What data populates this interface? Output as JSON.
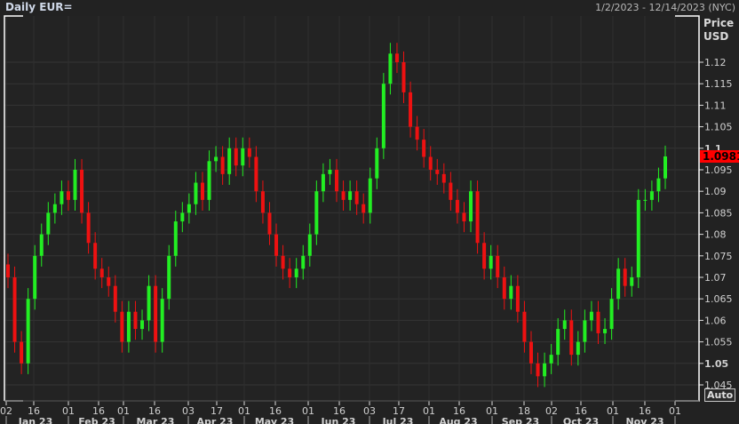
{
  "header": {
    "title": "Daily EUR=",
    "range": "1/2/2023 - 12/14/2023 (NYC)"
  },
  "auto_label": "Auto",
  "chart_data": {
    "type": "candlestick",
    "title": "Daily EUR=",
    "ylabel": "Price USD",
    "ylabel_lines": [
      "Price",
      "USD"
    ],
    "ylim": [
      1.043,
      1.127
    ],
    "yticks": [
      "1.045",
      "1.05",
      "1.055",
      "1.06",
      "1.065",
      "1.07",
      "1.075",
      "1.08",
      "1.085",
      "1.09",
      "1.095",
      "1.1",
      "1.105",
      "1.11",
      "1.115",
      "1.12"
    ],
    "ytick_values": [
      1.045,
      1.05,
      1.055,
      1.06,
      1.065,
      1.07,
      1.075,
      1.08,
      1.085,
      1.09,
      1.095,
      1.1,
      1.105,
      1.11,
      1.115,
      1.12
    ],
    "last_price": "1.0981",
    "last_price_value": 1.0981,
    "xticks": [
      "02",
      "16",
      "01",
      "16",
      "01",
      "16",
      "03",
      "17",
      "01",
      "16",
      "01",
      "16",
      "03",
      "17",
      "01",
      "16",
      "01",
      "18",
      "02",
      "16",
      "01",
      "16",
      "01"
    ],
    "months": [
      "Jan 23",
      "Feb 23",
      "Mar 23",
      "Apr 23",
      "May 23",
      "Jun 23",
      "Jul 23",
      "Aug 23",
      "Sep 23",
      "Oct 23",
      "Nov 23"
    ],
    "grid": true,
    "colors": {
      "up": "#22ee22",
      "down": "#ee1111",
      "background": "#222222",
      "grid": "#333333",
      "last_price_bg": "#ff0000"
    },
    "closes": [
      1.07,
      1.055,
      1.05,
      1.065,
      1.075,
      1.08,
      1.085,
      1.087,
      1.09,
      1.088,
      1.095,
      1.085,
      1.078,
      1.072,
      1.07,
      1.068,
      1.062,
      1.055,
      1.062,
      1.058,
      1.06,
      1.068,
      1.055,
      1.065,
      1.075,
      1.083,
      1.085,
      1.087,
      1.092,
      1.088,
      1.097,
      1.098,
      1.094,
      1.1,
      1.096,
      1.1,
      1.098,
      1.09,
      1.085,
      1.08,
      1.075,
      1.072,
      1.07,
      1.072,
      1.075,
      1.08,
      1.09,
      1.094,
      1.095,
      1.09,
      1.088,
      1.09,
      1.087,
      1.085,
      1.093,
      1.1,
      1.115,
      1.122,
      1.12,
      1.113,
      1.105,
      1.102,
      1.098,
      1.095,
      1.094,
      1.092,
      1.088,
      1.085,
      1.083,
      1.09,
      1.078,
      1.072,
      1.075,
      1.07,
      1.065,
      1.068,
      1.062,
      1.055,
      1.05,
      1.047,
      1.05,
      1.052,
      1.058,
      1.06,
      1.052,
      1.055,
      1.06,
      1.062,
      1.057,
      1.058,
      1.065,
      1.072,
      1.068,
      1.07,
      1.088,
      1.088,
      1.09,
      1.093,
      1.0981
    ]
  }
}
